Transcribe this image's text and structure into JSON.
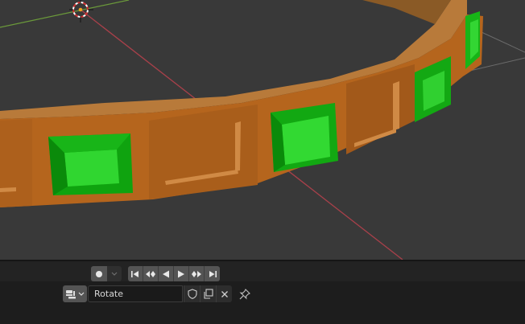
{
  "viewport": {
    "description_icon": "3d-viewport",
    "colors": {
      "background": "#393939",
      "wood": "#b5651d",
      "gem": "#22c522",
      "x_axis": "#a8404a",
      "y_axis": "#6b9a3a"
    }
  },
  "timeline": {
    "record_icon": "record-dot-icon",
    "keying_icon": "chevron-down-icon",
    "playback": [
      "jump-to-start-icon",
      "prev-keyframe-icon",
      "play-reverse-icon",
      "play-icon",
      "next-keyframe-icon",
      "jump-to-end-icon"
    ]
  },
  "action_editor": {
    "type_icon": "action-icon",
    "action_name": "Rotate",
    "buttons": [
      "fake-user-shield-icon",
      "new-action-copy-icon",
      "unlink-x-icon"
    ],
    "pin_icon": "pin-icon"
  }
}
